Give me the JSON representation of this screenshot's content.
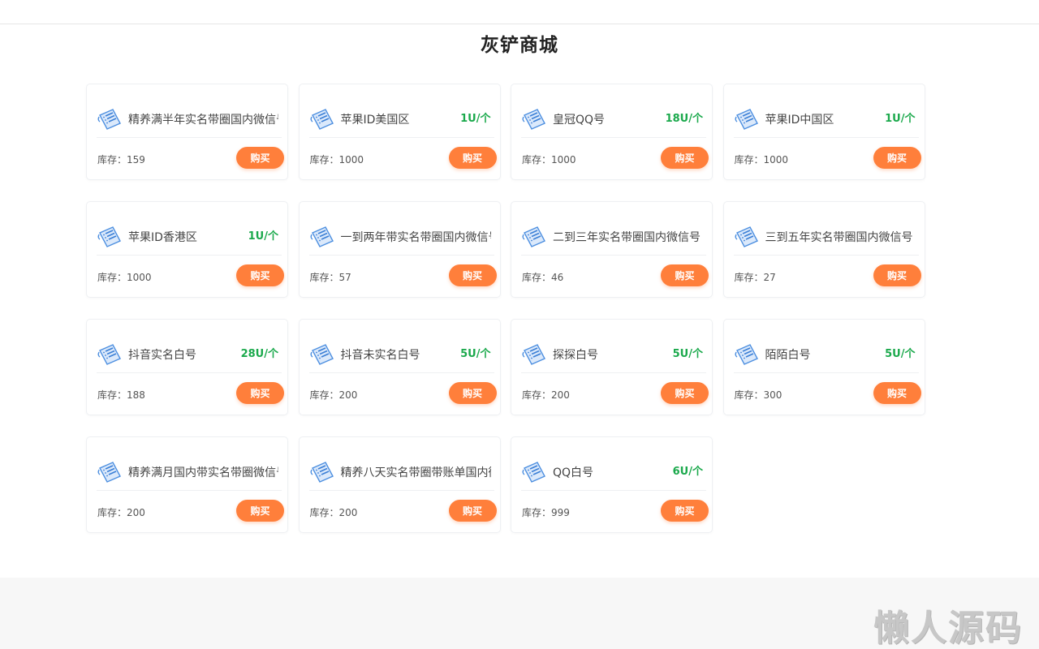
{
  "page": {
    "title": "灰铲商城"
  },
  "labels": {
    "stock_prefix": "库存：",
    "buy": "购买"
  },
  "colors": {
    "price": "#1ba94c",
    "buy_button": "#ff7f3b"
  },
  "products": [
    {
      "name": "精养满半年实名带圈国内微信号",
      "price": "",
      "stock": "159"
    },
    {
      "name": "苹果ID美国区",
      "price": "1U/个",
      "stock": "1000"
    },
    {
      "name": "皇冠QQ号",
      "price": "18U/个",
      "stock": "1000"
    },
    {
      "name": "苹果ID中国区",
      "price": "1U/个",
      "stock": "1000"
    },
    {
      "name": "苹果ID香港区",
      "price": "1U/个",
      "stock": "1000"
    },
    {
      "name": "一到两年带实名带圈国内微信号",
      "price": "",
      "stock": "57"
    },
    {
      "name": "二到三年实名带圈国内微信号",
      "price": "",
      "stock": "46"
    },
    {
      "name": "三到五年实名带圈国内微信号",
      "price": "",
      "stock": "27"
    },
    {
      "name": "抖音实名白号",
      "price": "28U/个",
      "stock": "188"
    },
    {
      "name": "抖音未实名白号",
      "price": "5U/个",
      "stock": "200"
    },
    {
      "name": "探探白号",
      "price": "5U/个",
      "stock": "200"
    },
    {
      "name": "陌陌白号",
      "price": "5U/个",
      "stock": "300"
    },
    {
      "name": "精养满月国内带实名带圈微信号",
      "price": "",
      "stock": "200"
    },
    {
      "name": "精养八天实名带圈带账单国内微信号",
      "price": "",
      "stock": "200"
    },
    {
      "name": "QQ白号",
      "price": "6U/个",
      "stock": "999"
    }
  ],
  "footer": {
    "watermark": "懒人源码"
  }
}
